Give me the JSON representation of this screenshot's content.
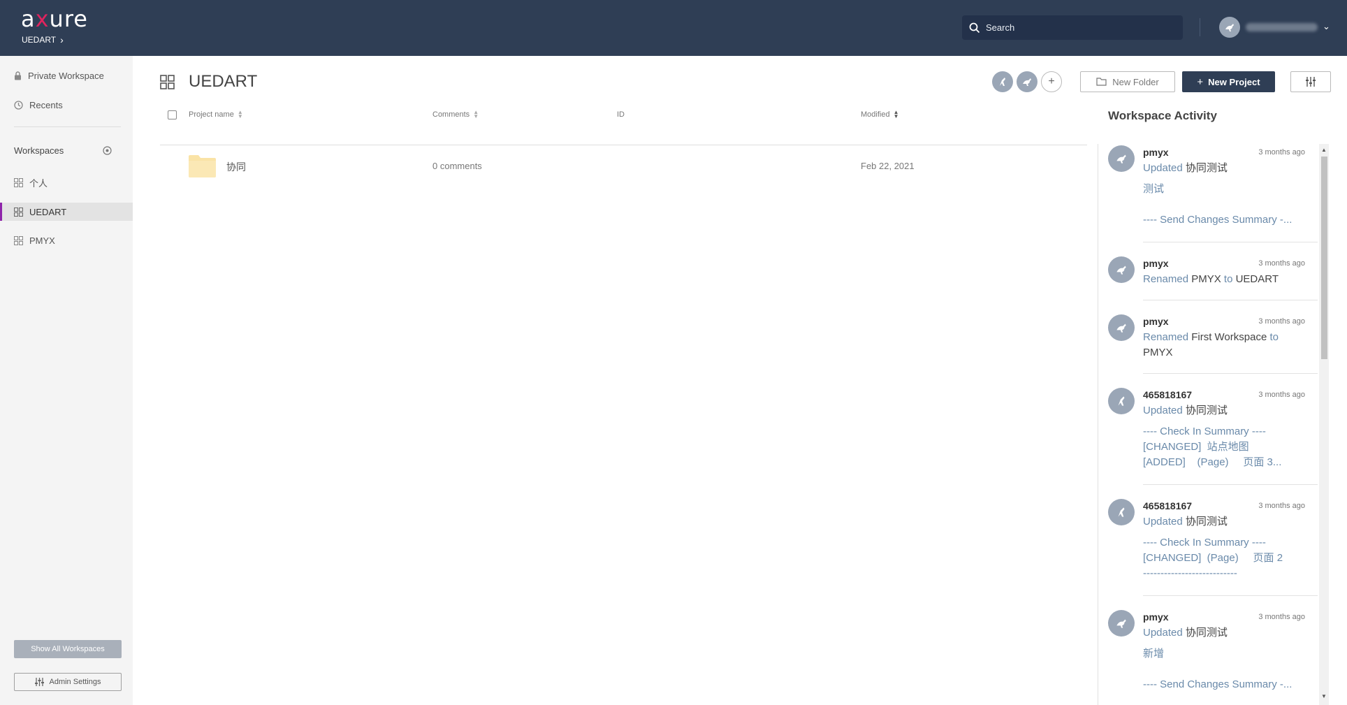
{
  "header": {
    "logo": {
      "prefix": "a",
      "accent": "x",
      "suffix": "ure"
    },
    "breadcrumb": "UEDART",
    "search_placeholder": "Search"
  },
  "sidebar": {
    "private_workspace": "Private Workspace",
    "recents": "Recents",
    "workspaces_heading": "Workspaces",
    "workspaces": [
      {
        "label": "个人",
        "active": false
      },
      {
        "label": "UEDART",
        "active": true
      },
      {
        "label": "PMYX",
        "active": false
      }
    ],
    "show_all_label": "Show All Workspaces",
    "admin_label": "Admin Settings"
  },
  "main": {
    "title": "UEDART",
    "new_folder_label": "New Folder",
    "new_project_label": "New Project",
    "columns": {
      "name": "Project name",
      "comments": "Comments",
      "id": "ID",
      "modified": "Modified"
    },
    "rows": [
      {
        "name": "协同",
        "comments": "0 comments",
        "id": "",
        "modified": "Feb 22, 2021"
      }
    ]
  },
  "activity": {
    "title": "Workspace Activity",
    "items": [
      {
        "user": "pmyx",
        "time": "3 months ago",
        "action": "Updated",
        "target": "协同测试",
        "detail": "测试\n\n---- Send Changes Summary -..."
      },
      {
        "user": "pmyx",
        "time": "3 months ago",
        "action": "Renamed",
        "from": "PMYX",
        "to_word": "to",
        "target": "UEDART"
      },
      {
        "user": "pmyx",
        "time": "3 months ago",
        "action": "Renamed",
        "from": "First Workspace",
        "to_word": "to",
        "target": "PMYX"
      },
      {
        "user": "465818167",
        "time": "3 months ago",
        "action": "Updated",
        "target": "协同测试",
        "detail": "---- Check In Summary ----\n[CHANGED]  站点地图\n[ADDED]    (Page)     页面 3..."
      },
      {
        "user": "465818167",
        "time": "3 months ago",
        "action": "Updated",
        "target": "协同测试",
        "detail": "---- Check In Summary ----\n[CHANGED]  (Page)     页面 2\n---------------------------"
      },
      {
        "user": "pmyx",
        "time": "3 months ago",
        "action": "Updated",
        "target": "协同测试",
        "detail": "新增\n\n---- Send Changes Summary -..."
      }
    ]
  },
  "colors": {
    "header_bg": "#2f3e55",
    "logo_accent": "#e0245e",
    "active_marker": "#8e24aa",
    "primary_button": "#2f3e55",
    "link_text": "#6a8aaa"
  },
  "icons": [
    "search-icon",
    "lock-icon",
    "clock-icon",
    "add-circle-icon",
    "grid-icon",
    "folder-icon",
    "plus-icon",
    "filter-icon",
    "kangaroo-avatar-icon",
    "sort-icon"
  ]
}
